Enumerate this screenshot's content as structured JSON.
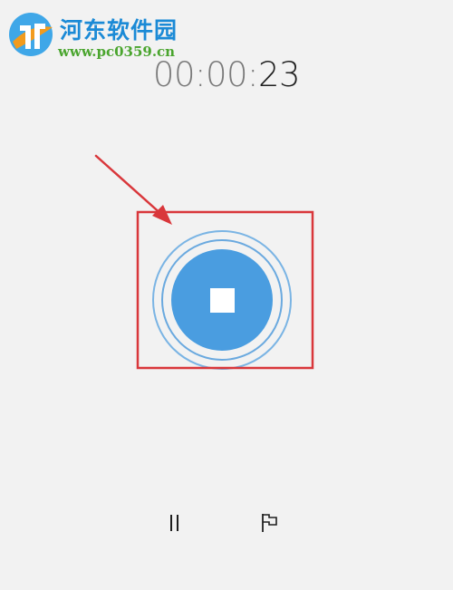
{
  "watermark": {
    "title": "河东软件园",
    "url": "www.pc0359.cn"
  },
  "timer": {
    "hours_minutes": "00:00:",
    "seconds": "23"
  },
  "controls": {
    "record_icon": "stop-icon",
    "pause_icon": "pause-icon",
    "flag_icon": "flag-icon"
  },
  "colors": {
    "accent": "#4a9de0",
    "annotation": "#d9373b",
    "background": "#f2f2f2"
  }
}
